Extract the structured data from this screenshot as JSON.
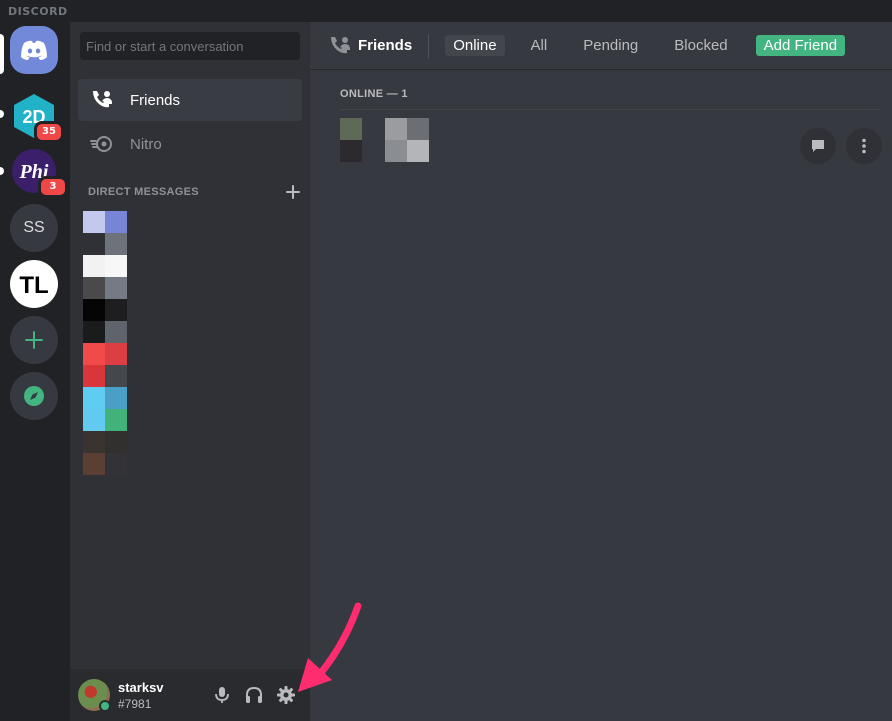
{
  "app": {
    "wordmark": "DISCORD"
  },
  "servers": [
    {
      "id": "home",
      "icon": "discord-logo-icon"
    },
    {
      "id": "2d",
      "label": "2D",
      "badge": "35"
    },
    {
      "id": "phi",
      "label": "Phi",
      "badge": "3"
    },
    {
      "id": "ss",
      "label": "SS"
    },
    {
      "id": "tl",
      "label": "TL"
    },
    {
      "id": "add",
      "icon": "plus-icon"
    },
    {
      "id": "explore",
      "icon": "compass-icon"
    }
  ],
  "sidebar": {
    "search_placeholder": "Find or start a conversation",
    "items": [
      {
        "label": "Friends",
        "icon": "friends-icon",
        "active": true
      },
      {
        "label": "Nitro",
        "icon": "nitro-icon",
        "active": false
      }
    ],
    "dm_header": "DIRECT MESSAGES"
  },
  "user": {
    "name": "starksv",
    "tag": "#7981",
    "status_color": "#43b581"
  },
  "main": {
    "title": "Friends",
    "tabs": [
      {
        "label": "Online",
        "selected": true
      },
      {
        "label": "All"
      },
      {
        "label": "Pending"
      },
      {
        "label": "Blocked"
      },
      {
        "label": "Add Friend",
        "primary": true
      }
    ],
    "section_title": "ONLINE — 1"
  },
  "colors": {
    "blurple": "#7289da",
    "green": "#43b581",
    "red": "#f04747",
    "arrow": "#ff2d6f"
  }
}
